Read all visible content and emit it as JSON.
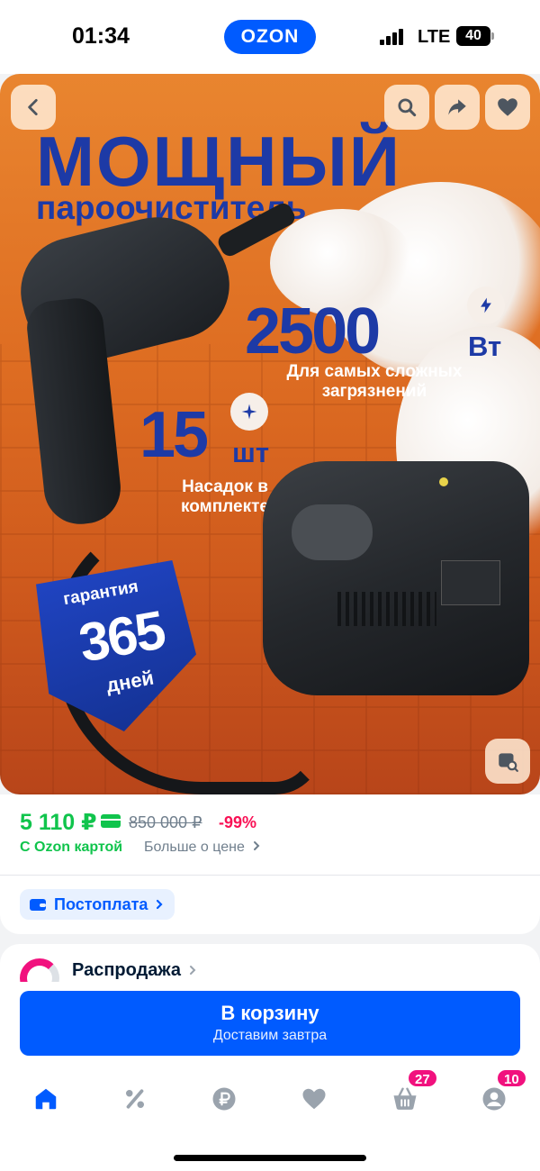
{
  "status_bar": {
    "time": "01:34",
    "network": "LTE",
    "battery": "40"
  },
  "header": {
    "logo": "OZON"
  },
  "product_image": {
    "headline_1": "МОЩНЫЙ",
    "headline_2": "пароочиститель",
    "power_value": "2500",
    "power_unit": "Вт",
    "power_caption": "Для самых сложных загрязнений",
    "nozzle_count": "15",
    "nozzle_unit": "шт",
    "nozzle_caption": "Насадок в комплекте",
    "warranty_top": "гарантия",
    "warranty_days": "365",
    "warranty_bottom": "дней",
    "buttons": [
      "back-icon",
      "search-icon",
      "share-icon",
      "favorite-icon",
      "image-search-icon"
    ]
  },
  "price": {
    "current": "5 110 ₽",
    "old": "850 000 ₽",
    "discount": "-99%",
    "ozon_card_label": "С Ozon картой",
    "more_link": "Больше о цене",
    "colors": {
      "green": "#10c44c",
      "pink": "#f91155",
      "gray": "#707f8d"
    }
  },
  "postpay": {
    "label": "Постоплата"
  },
  "sale": {
    "label": "Распродажа"
  },
  "cart": {
    "title": "В корзину",
    "subtitle": "Доставим завтра",
    "color": "#005bff"
  },
  "tab_bar": {
    "items": [
      {
        "name": "home",
        "icon": "home-icon"
      },
      {
        "name": "discounts",
        "icon": "percent-icon"
      },
      {
        "name": "ruble",
        "icon": "ruble-icon"
      },
      {
        "name": "favorites",
        "icon": "heart-icon"
      },
      {
        "name": "cart",
        "icon": "basket-icon",
        "badge": "27"
      },
      {
        "name": "profile",
        "icon": "profile-icon",
        "badge": "10"
      }
    ]
  }
}
